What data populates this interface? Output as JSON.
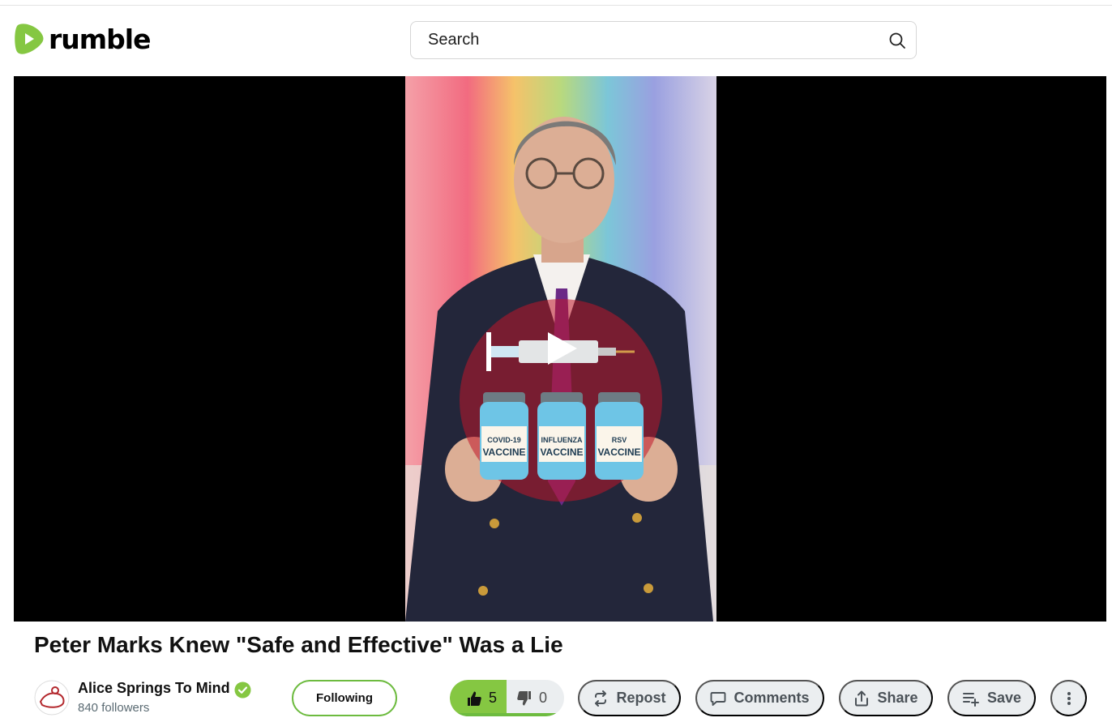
{
  "header": {
    "logo_text": "rumble",
    "search_placeholder": "Search"
  },
  "video": {
    "title": "Peter Marks Knew \"Safe and Effective\" Was a Lie",
    "overlay_labels": [
      "COVID-19",
      "VACCINE",
      "INFLUENZA",
      "VACCINE",
      "RSV",
      "VACCINE"
    ]
  },
  "channel": {
    "name": "Alice Springs To Mind",
    "followers": "840 followers",
    "follow_button": "Following"
  },
  "actions": {
    "likes": "5",
    "dislikes": "0",
    "like_fraction": 1.0,
    "repost": "Repost",
    "comments": "Comments",
    "share": "Share",
    "save": "Save"
  },
  "colors": {
    "brand": "#85c742",
    "accent_border": "#6dbb3f",
    "pill_bg": "#ebeef0"
  },
  "icons": [
    "rumble-logo-icon",
    "search-icon",
    "play-icon",
    "verified-icon",
    "thumbs-up-icon",
    "thumbs-down-icon",
    "repost-icon",
    "comment-icon",
    "share-icon",
    "playlist-add-icon",
    "more-vertical-icon"
  ]
}
